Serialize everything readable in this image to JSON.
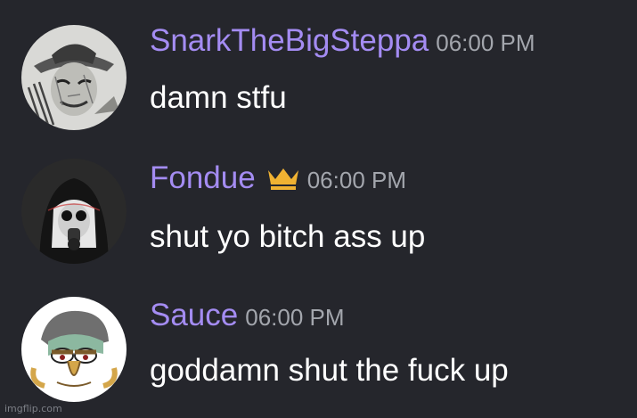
{
  "colors": {
    "background": "#25262c",
    "username": "#a48cf2",
    "timestamp": "#a3a6ad",
    "message_text": "#ffffff",
    "crown": "#f0b232"
  },
  "messages": [
    {
      "username": "SnarkTheBigSteppa",
      "timestamp": "06:00 PM",
      "content": "damn stfu",
      "avatar_icon": "horror-character-sketch-avatar",
      "has_crown": false
    },
    {
      "username": "Fondue",
      "timestamp": "06:00 PM",
      "content": "shut yo bitch ass up",
      "avatar_icon": "gas-mask-nun-avatar",
      "has_crown": true,
      "badge_icon": "crown-icon"
    },
    {
      "username": "Sauce",
      "timestamp": "06:00 PM",
      "content": "goddamn shut the fuck up",
      "avatar_icon": "cartoon-face-avatar",
      "has_crown": false
    }
  ],
  "watermark": "imgflip.com"
}
